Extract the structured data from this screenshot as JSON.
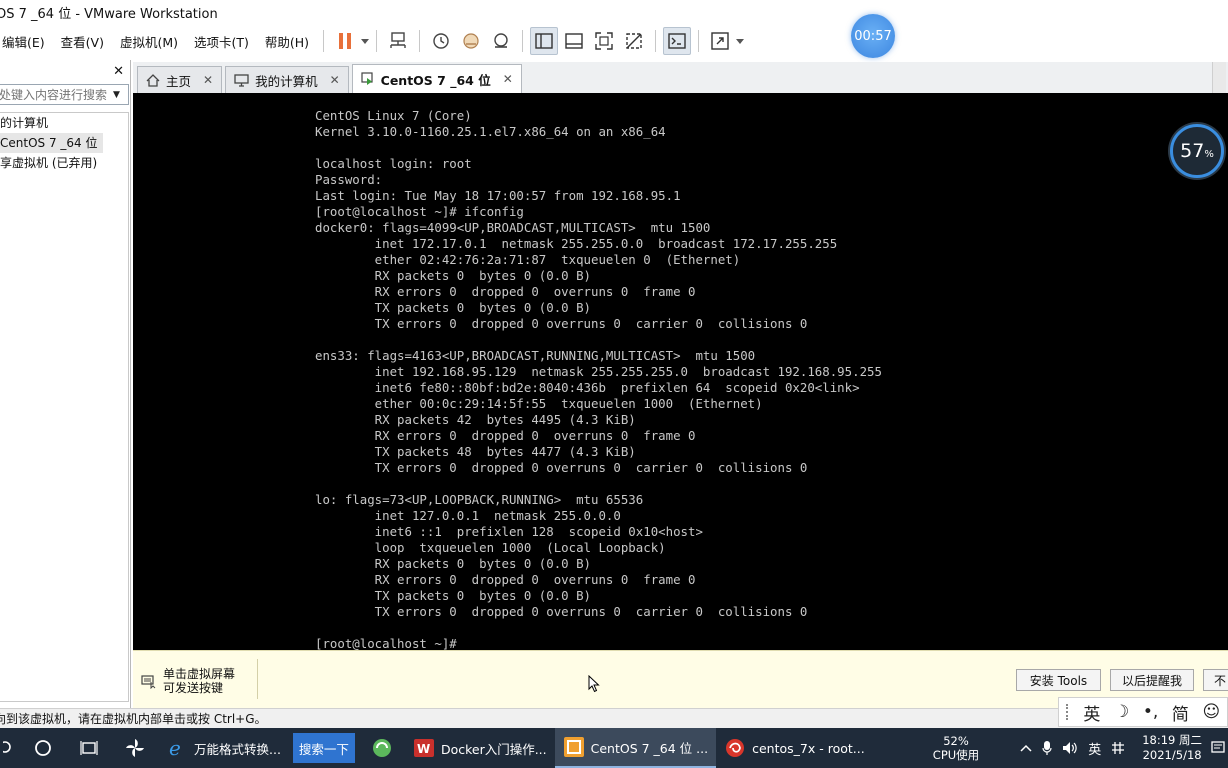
{
  "window": {
    "title": "OS 7 _64 位  - VMware Workstation"
  },
  "menu": [
    "编辑(E)",
    "查看(V)",
    "虚拟机(M)",
    "选项卡(T)",
    "帮助(H)"
  ],
  "timer": "00:57",
  "sidebar": {
    "close": "✕",
    "search_placeholder": "处键入内容进行搜索",
    "items": [
      {
        "label": "的计算机"
      },
      {
        "label": "CentOS 7 _64 位"
      },
      {
        "label": "享虚拟机 (已弃用)"
      }
    ]
  },
  "tabs": [
    {
      "label": "主页",
      "close": "✕"
    },
    {
      "label": "我的计算机",
      "close": "✕"
    },
    {
      "label": "CentOS 7 _64 位",
      "close": "✕"
    }
  ],
  "console_lines": [
    "CentOS Linux 7 (Core)",
    "Kernel 3.10.0-1160.25.1.el7.x86_64 on an x86_64",
    "",
    "localhost login: root",
    "Password:",
    "Last login: Tue May 18 17:00:57 from 192.168.95.1",
    "[root@localhost ~]# ifconfig",
    "docker0: flags=4099<UP,BROADCAST,MULTICAST>  mtu 1500",
    "        inet 172.17.0.1  netmask 255.255.0.0  broadcast 172.17.255.255",
    "        ether 02:42:76:2a:71:87  txqueuelen 0  (Ethernet)",
    "        RX packets 0  bytes 0 (0.0 B)",
    "        RX errors 0  dropped 0  overruns 0  frame 0",
    "        TX packets 0  bytes 0 (0.0 B)",
    "        TX errors 0  dropped 0 overruns 0  carrier 0  collisions 0",
    "",
    "ens33: flags=4163<UP,BROADCAST,RUNNING,MULTICAST>  mtu 1500",
    "        inet 192.168.95.129  netmask 255.255.255.0  broadcast 192.168.95.255",
    "        inet6 fe80::80bf:bd2e:8040:436b  prefixlen 64  scopeid 0x20<link>",
    "        ether 00:0c:29:14:5f:55  txqueuelen 1000  (Ethernet)",
    "        RX packets 42  bytes 4495 (4.3 KiB)",
    "        RX errors 0  dropped 0  overruns 0  frame 0",
    "        TX packets 48  bytes 4477 (4.3 KiB)",
    "        TX errors 0  dropped 0 overruns 0  carrier 0  collisions 0",
    "",
    "lo: flags=73<UP,LOOPBACK,RUNNING>  mtu 65536",
    "        inet 127.0.0.1  netmask 255.0.0.0",
    "        inet6 ::1  prefixlen 128  scopeid 0x10<host>",
    "        loop  txqueuelen 1000  (Local Loopback)",
    "        RX packets 0  bytes 0 (0.0 B)",
    "        RX errors 0  dropped 0  overruns 0  frame 0",
    "        TX packets 0  bytes 0 (0.0 B)",
    "        TX errors 0  dropped 0 overruns 0  carrier 0  collisions 0",
    "",
    "[root@localhost ~]#"
  ],
  "cpu_ring": {
    "value": "57",
    "unit": "%"
  },
  "hint": {
    "line1": "单击虚拟屏幕",
    "line2": "可发送按键",
    "install_tools": "安装 Tools",
    "remind_later": "以后提醒我",
    "never": "不"
  },
  "status": "向到该虚拟机，请在虚拟机内部单击或按 Ctrl+G。",
  "ime": {
    "lang": "英",
    "moon": "☽",
    "punct": "•,",
    "simplified": "简",
    "emoji": "☺"
  },
  "taskbar": {
    "apps": [
      {
        "label": "万能格式转换..."
      },
      {
        "label": "Docker入门操作..."
      },
      {
        "label": "CentOS 7 _64 位 ..."
      },
      {
        "label": "centos_7x - root..."
      }
    ],
    "search_label": "搜索一下",
    "cpu_percent": "52%",
    "cpu_label": "CPU使用",
    "ime_lang": "英",
    "time": "18:19 周二",
    "date": "2021/5/18"
  },
  "colors": {
    "console_bg": "#000000",
    "console_fg": "#c8c8c8",
    "taskbar_bg": "#1f2b3a",
    "hint_bg": "#fffde6",
    "accent": "#3c86e0"
  }
}
